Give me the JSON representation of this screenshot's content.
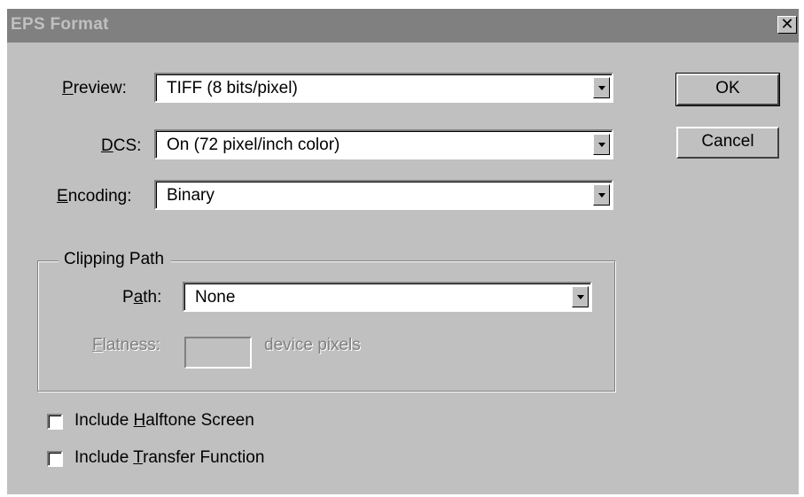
{
  "window": {
    "title": "EPS Format",
    "close_glyph": "✕"
  },
  "preview": {
    "label_prefix": "",
    "label_accel": "P",
    "label_rest": "review:",
    "value": "TIFF  (8 bits/pixel)"
  },
  "dcs": {
    "label_accel": "D",
    "label_rest": "CS:",
    "value": "On  (72 pixel/inch color)"
  },
  "encoding": {
    "label_accel": "E",
    "label_rest": "ncoding:",
    "value": "Binary"
  },
  "clipping_path": {
    "group_label": "Clipping Path",
    "path_label_prefix": "P",
    "path_label_accel": "a",
    "path_label_rest": "th:",
    "path_value": "None",
    "flatness_label_accel": "F",
    "flatness_label_rest": "latness:",
    "flatness_value": "",
    "flatness_unit": "device pixels"
  },
  "options": {
    "halftone_prefix": "Include ",
    "halftone_accel": "H",
    "halftone_rest": "alftone Screen",
    "halftone_checked": false,
    "transfer_prefix": "Include ",
    "transfer_accel": "T",
    "transfer_rest": "ransfer Function",
    "transfer_checked": false
  },
  "buttons": {
    "ok": "OK",
    "cancel": "Cancel"
  },
  "icons": {
    "close": "close-icon",
    "dropdown": "chevron-down-icon"
  },
  "colors": {
    "face": "#c0c0c0",
    "title_inactive": "#808080",
    "disabled_text": "#808080"
  }
}
